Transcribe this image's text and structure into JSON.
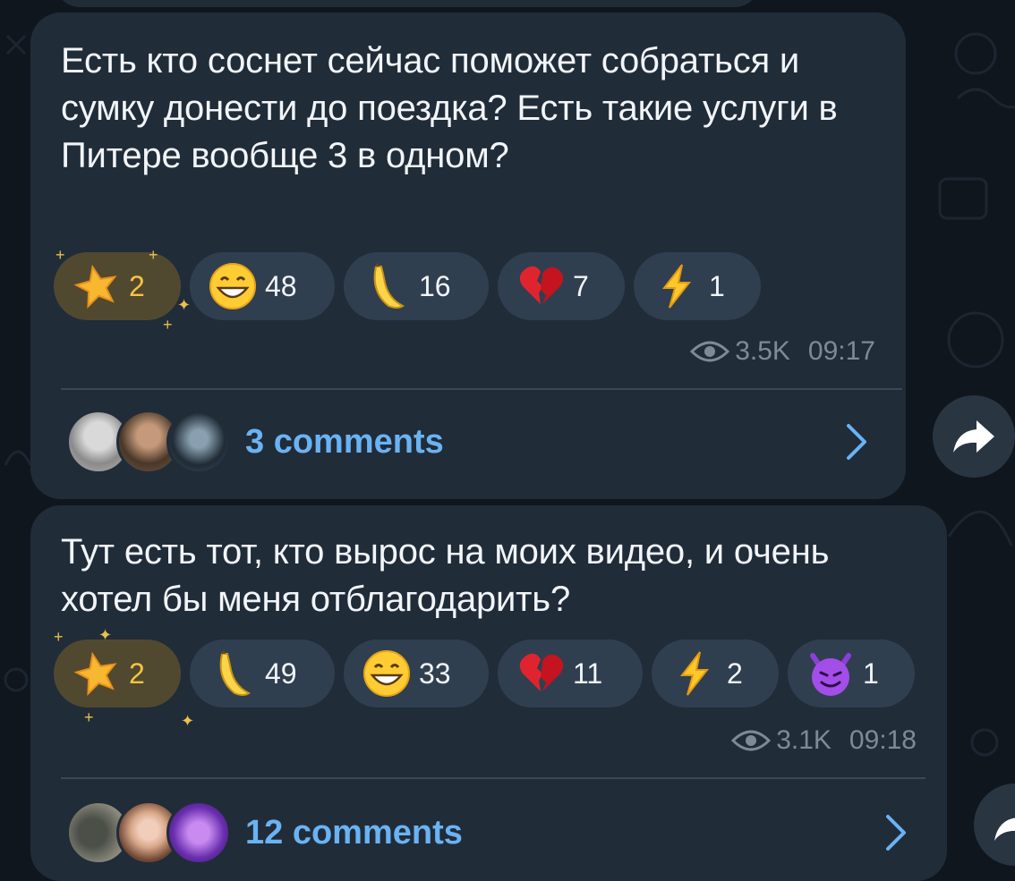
{
  "messages": [
    {
      "text": "Есть кто соснет сейчас поможет собраться и сумку донести до поездка? Есть такие услуги в Питере вообще 3 в одном?",
      "reactions": [
        {
          "icon": "star-icon",
          "count": "2",
          "paid": true
        },
        {
          "icon": "grinning-face-icon",
          "count": "48"
        },
        {
          "icon": "banana-icon",
          "count": "16"
        },
        {
          "icon": "broken-heart-icon",
          "count": "7"
        },
        {
          "icon": "lightning-icon",
          "count": "1"
        }
      ],
      "views": "3.5K",
      "time": "09:17",
      "comments_label": "3 comments"
    },
    {
      "text": "Тут есть тот, кто вырос на моих видео, и очень хотел бы меня отблагодарить?",
      "reactions": [
        {
          "icon": "star-icon",
          "count": "2",
          "paid": true
        },
        {
          "icon": "banana-icon",
          "count": "49"
        },
        {
          "icon": "grinning-face-icon",
          "count": "33"
        },
        {
          "icon": "broken-heart-icon",
          "count": "11"
        },
        {
          "icon": "lightning-icon",
          "count": "2"
        },
        {
          "icon": "smiling-devil-icon",
          "count": "1"
        }
      ],
      "views": "3.1K",
      "time": "09:18",
      "comments_label": "12 comments"
    }
  ],
  "colors": {
    "background": "#0f161e",
    "bubble": "#212c39",
    "pill": "#303f50",
    "paid_pill": "#51492f",
    "link": "#6ab3f3",
    "meta": "#7d8a98"
  }
}
